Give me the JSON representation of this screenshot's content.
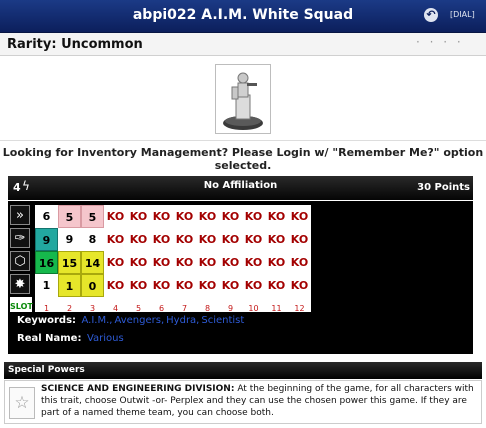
{
  "header": {
    "title": "abpi022 A.I.M. White Squad",
    "dial_link": "[DIAL]"
  },
  "rarity": {
    "label": "Rarity: Uncommon",
    "dots": "· · · ·"
  },
  "inventory_message": {
    "line1": "Looking for Inventory Management? Please Login w/ \"Remember Me?\" option",
    "line2": "selected."
  },
  "dial": {
    "range": "4",
    "affiliation": "No Affiliation",
    "points": "30 Points",
    "icons": [
      "speed-icon",
      "attack-icon",
      "defense-icon",
      "damage-icon"
    ],
    "rows": [
      [
        {
          "v": "6",
          "c": ""
        },
        {
          "v": "5",
          "c": "pink"
        },
        {
          "v": "5",
          "c": "pink"
        },
        {
          "v": "KO",
          "c": "ko"
        },
        {
          "v": "KO",
          "c": "ko"
        },
        {
          "v": "KO",
          "c": "ko"
        },
        {
          "v": "KO",
          "c": "ko"
        },
        {
          "v": "KO",
          "c": "ko"
        },
        {
          "v": "KO",
          "c": "ko"
        },
        {
          "v": "KO",
          "c": "ko"
        },
        {
          "v": "KO",
          "c": "ko"
        },
        {
          "v": "KO",
          "c": "ko"
        }
      ],
      [
        {
          "v": "9",
          "c": "teal"
        },
        {
          "v": "9",
          "c": ""
        },
        {
          "v": "8",
          "c": ""
        },
        {
          "v": "KO",
          "c": "ko"
        },
        {
          "v": "KO",
          "c": "ko"
        },
        {
          "v": "KO",
          "c": "ko"
        },
        {
          "v": "KO",
          "c": "ko"
        },
        {
          "v": "KO",
          "c": "ko"
        },
        {
          "v": "KO",
          "c": "ko"
        },
        {
          "v": "KO",
          "c": "ko"
        },
        {
          "v": "KO",
          "c": "ko"
        },
        {
          "v": "KO",
          "c": "ko"
        }
      ],
      [
        {
          "v": "16",
          "c": "green"
        },
        {
          "v": "15",
          "c": "yellow"
        },
        {
          "v": "14",
          "c": "yellow"
        },
        {
          "v": "KO",
          "c": "ko"
        },
        {
          "v": "KO",
          "c": "ko"
        },
        {
          "v": "KO",
          "c": "ko"
        },
        {
          "v": "KO",
          "c": "ko"
        },
        {
          "v": "KO",
          "c": "ko"
        },
        {
          "v": "KO",
          "c": "ko"
        },
        {
          "v": "KO",
          "c": "ko"
        },
        {
          "v": "KO",
          "c": "ko"
        },
        {
          "v": "KO",
          "c": "ko"
        }
      ],
      [
        {
          "v": "1",
          "c": ""
        },
        {
          "v": "1",
          "c": "yellow"
        },
        {
          "v": "0",
          "c": "yellow"
        },
        {
          "v": "KO",
          "c": "ko"
        },
        {
          "v": "KO",
          "c": "ko"
        },
        {
          "v": "KO",
          "c": "ko"
        },
        {
          "v": "KO",
          "c": "ko"
        },
        {
          "v": "KO",
          "c": "ko"
        },
        {
          "v": "KO",
          "c": "ko"
        },
        {
          "v": "KO",
          "c": "ko"
        },
        {
          "v": "KO",
          "c": "ko"
        },
        {
          "v": "KO",
          "c": "ko"
        }
      ]
    ],
    "slot_label": "SLOT",
    "slots": [
      "1",
      "2",
      "3",
      "4",
      "5",
      "6",
      "7",
      "8",
      "9",
      "10",
      "11",
      "12"
    ]
  },
  "keywords": {
    "label": "Keywords:",
    "items": [
      "A.I.M.",
      "Avengers",
      "Hydra",
      "Scientist"
    ]
  },
  "real_name": {
    "label": "Real Name:",
    "value": "Various"
  },
  "special_powers": {
    "title": "Special Powers",
    "name": "SCIENCE AND ENGINEERING DIVISION:",
    "text": "At the beginning of the game, for all characters with this trait, choose Outwit -or- Perplex and they can use the chosen power this game. If they are part of a named theme team, you can choose both."
  }
}
